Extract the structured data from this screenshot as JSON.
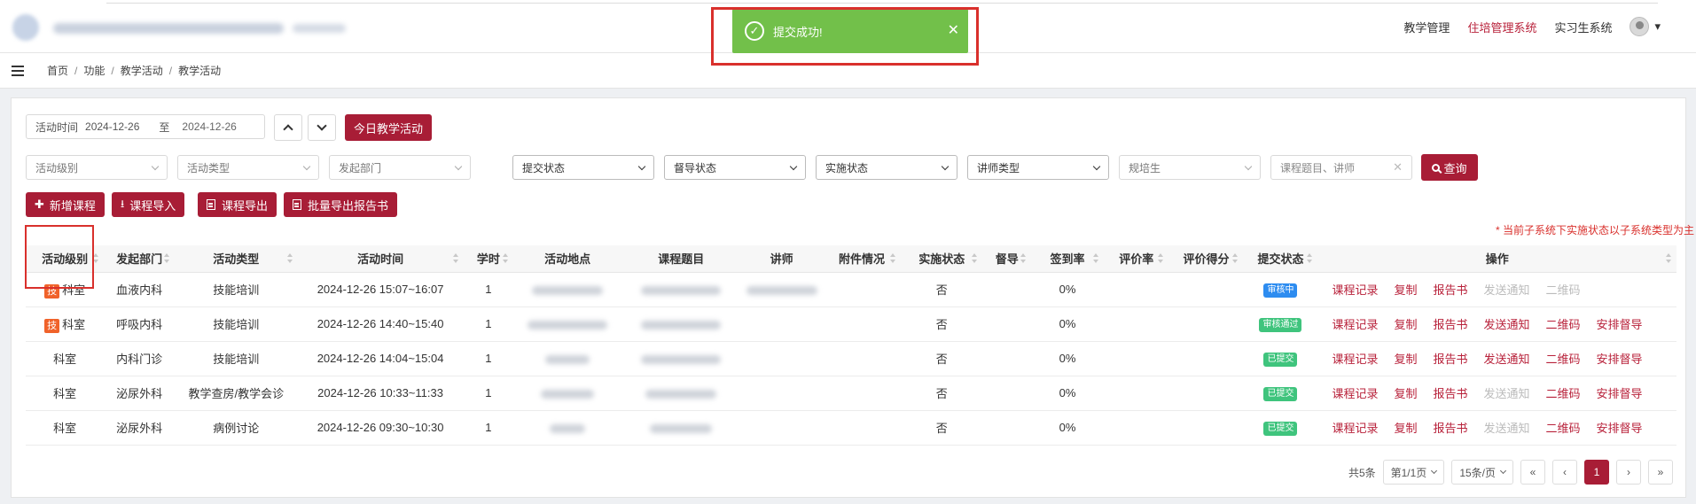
{
  "topnav": {
    "items": [
      {
        "label": "教学管理",
        "active": false
      },
      {
        "label": "住培管理系统",
        "active": true
      },
      {
        "label": "实习生系统",
        "active": false
      }
    ],
    "accent_color": "#b8213a"
  },
  "breadcrumb": [
    "首页",
    "功能",
    "教学活动",
    "教学活动"
  ],
  "toast": {
    "message": "提交成功!",
    "color": "#72c04a"
  },
  "filters": {
    "date_label": "活动时间",
    "date_from": "2024-12-26",
    "date_to_label": "至",
    "date_to": "2024-12-26",
    "today_button": "今日教学活动",
    "selects": [
      {
        "placeholder": "活动级别"
      },
      {
        "placeholder": "活动类型"
      },
      {
        "placeholder": "发起部门"
      },
      {
        "placeholder": "提交状态"
      },
      {
        "placeholder": "督导状态"
      },
      {
        "placeholder": "实施状态"
      },
      {
        "placeholder": "讲师类型"
      },
      {
        "placeholder": "规培生"
      }
    ],
    "search_placeholder": "课程题目、讲师",
    "query_button": "查询"
  },
  "actions": {
    "add": "新增课程",
    "import": "课程导入",
    "export": "课程导出",
    "batch_export": "批量导出报告书"
  },
  "note": "* 当前子系统下实施状态以子系统类型为主",
  "table": {
    "columns": [
      "活动级别",
      "发起部门",
      "活动类型",
      "活动时间",
      "学时",
      "活动地点",
      "课程题目",
      "讲师",
      "附件情况",
      "实施状态",
      "督导",
      "签到率",
      "评价率",
      "评价得分",
      "提交状态",
      "操作"
    ],
    "rows": [
      {
        "tag": "技",
        "level": "科室",
        "dept": "血液内科",
        "type": "技能培训",
        "time": "2024-12-26 15:07~16:07",
        "hours": "1",
        "impl": "否",
        "signin": "0%",
        "status": "审核中",
        "status_color": "#2d8cf0",
        "ops": [
          {
            "t": "课程记录",
            "d": false
          },
          {
            "t": "复制",
            "d": false
          },
          {
            "t": "报告书",
            "d": false
          },
          {
            "t": "发送通知",
            "d": true
          },
          {
            "t": "二维码",
            "d": true
          }
        ]
      },
      {
        "tag": "技",
        "level": "科室",
        "dept": "呼吸内科",
        "type": "技能培训",
        "time": "2024-12-26 14:40~15:40",
        "hours": "1",
        "impl": "否",
        "signin": "0%",
        "status": "审核通过",
        "status_color": "#3fc47d",
        "ops": [
          {
            "t": "课程记录",
            "d": false
          },
          {
            "t": "复制",
            "d": false
          },
          {
            "t": "报告书",
            "d": false
          },
          {
            "t": "发送通知",
            "d": false
          },
          {
            "t": "二维码",
            "d": false
          },
          {
            "t": "安排督导",
            "d": false
          }
        ]
      },
      {
        "tag": "",
        "level": "科室",
        "dept": "内科门诊",
        "type": "技能培训",
        "time": "2024-12-26 14:04~15:04",
        "hours": "1",
        "impl": "否",
        "signin": "0%",
        "status": "已提交",
        "status_color": "#3fc47d",
        "ops": [
          {
            "t": "课程记录",
            "d": false
          },
          {
            "t": "复制",
            "d": false
          },
          {
            "t": "报告书",
            "d": false
          },
          {
            "t": "发送通知",
            "d": false
          },
          {
            "t": "二维码",
            "d": false
          },
          {
            "t": "安排督导",
            "d": false
          }
        ]
      },
      {
        "tag": "",
        "level": "科室",
        "dept": "泌尿外科",
        "type": "教学查房/教学会诊",
        "time": "2024-12-26 10:33~11:33",
        "hours": "1",
        "impl": "否",
        "signin": "0%",
        "status": "已提交",
        "status_color": "#3fc47d",
        "ops": [
          {
            "t": "课程记录",
            "d": false
          },
          {
            "t": "复制",
            "d": false
          },
          {
            "t": "报告书",
            "d": false
          },
          {
            "t": "发送通知",
            "d": true
          },
          {
            "t": "二维码",
            "d": false
          },
          {
            "t": "安排督导",
            "d": false
          }
        ]
      },
      {
        "tag": "",
        "level": "科室",
        "dept": "泌尿外科",
        "type": "病例讨论",
        "time": "2024-12-26 09:30~10:30",
        "hours": "1",
        "impl": "否",
        "signin": "0%",
        "status": "已提交",
        "status_color": "#3fc47d",
        "ops": [
          {
            "t": "课程记录",
            "d": false
          },
          {
            "t": "复制",
            "d": false
          },
          {
            "t": "报告书",
            "d": false
          },
          {
            "t": "发送通知",
            "d": true
          },
          {
            "t": "二维码",
            "d": false
          },
          {
            "t": "安排督导",
            "d": false
          }
        ]
      }
    ]
  },
  "pagination": {
    "total": "共5条",
    "page_info": "第1/1页",
    "page_size": "15条/页",
    "first": "«",
    "prev": "‹",
    "current": "1",
    "next": "›",
    "last": "»"
  }
}
